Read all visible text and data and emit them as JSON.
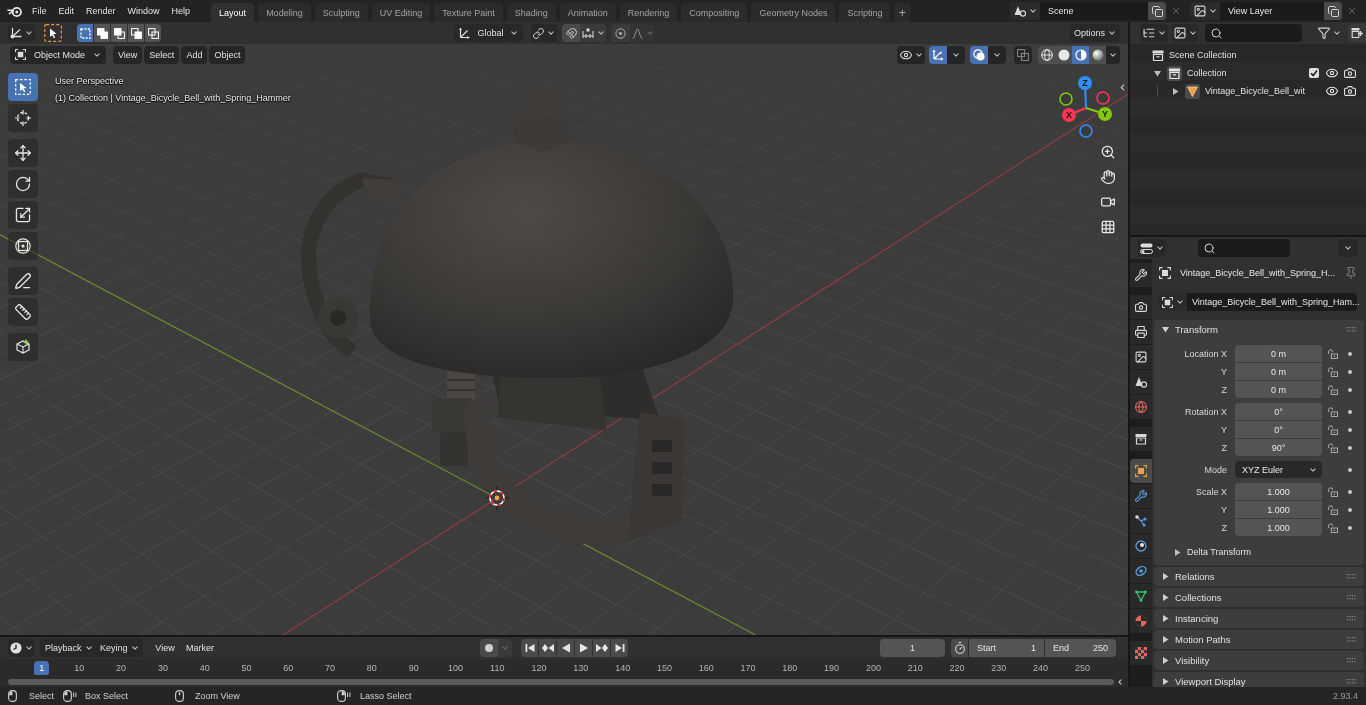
{
  "top_bar": {
    "menus": [
      "File",
      "Edit",
      "Render",
      "Window",
      "Help"
    ],
    "workspaces": [
      {
        "label": "Layout",
        "selected": true
      },
      {
        "label": "Modeling",
        "selected": false
      },
      {
        "label": "Sculpting",
        "selected": false
      },
      {
        "label": "UV Editing",
        "selected": false
      },
      {
        "label": "Texture Paint",
        "selected": false
      },
      {
        "label": "Shading",
        "selected": false
      },
      {
        "label": "Animation",
        "selected": false
      },
      {
        "label": "Rendering",
        "selected": false
      },
      {
        "label": "Compositing",
        "selected": false
      },
      {
        "label": "Geometry Nodes",
        "selected": false
      },
      {
        "label": "Scripting",
        "selected": false
      }
    ],
    "add_workspace": "+",
    "scene": "Scene",
    "view_layer": "View Layer"
  },
  "viewport": {
    "tool_header": {
      "select_modes": [
        {
          "selected": true
        },
        {
          "selected": false
        },
        {
          "selected": false
        },
        {
          "selected": false
        },
        {
          "selected": false
        }
      ],
      "orientation": "Global",
      "snap_on": false,
      "proportional_on": false,
      "options": "Options"
    },
    "header": {
      "mode": "Object Mode",
      "menus": [
        "View",
        "Select",
        "Add",
        "Object"
      ],
      "gizmos_on": true,
      "overlays_on": true,
      "xray_on": false,
      "shading": [
        {
          "selected": false
        },
        {
          "selected": false
        },
        {
          "selected": true
        },
        {
          "selected": false
        }
      ]
    },
    "tools": [
      {
        "selected": true
      },
      {
        "selected": false
      },
      {
        "selected": false
      },
      {
        "selected": false
      },
      {
        "selected": false
      },
      {
        "selected": false
      },
      {
        "selected": false
      },
      {
        "selected": false
      },
      {
        "selected": false
      }
    ],
    "info": [
      "User Perspective",
      "(1) Collection | Vintage_Bicycle_Bell_with_Spring_Hammer"
    ],
    "gizmo_axes": [
      "Z",
      "Y",
      "X"
    ]
  },
  "timeline": {
    "menus": [
      {
        "label": "Playback",
        "kind": "dropdown"
      },
      {
        "label": "Keying",
        "kind": "dropdown"
      },
      {
        "label": "View",
        "kind": "menu"
      },
      {
        "label": "Marker",
        "kind": "menu"
      }
    ],
    "current_frame": "1",
    "start": {
      "label": "Start",
      "value": "1"
    },
    "end": {
      "label": "End",
      "value": "250"
    },
    "frames": [
      {
        "label": "1",
        "selected": true
      },
      {
        "label": "10",
        "selected": false
      },
      {
        "label": "20",
        "selected": false
      },
      {
        "label": "30",
        "selected": false
      },
      {
        "label": "40",
        "selected": false
      },
      {
        "label": "50",
        "selected": false
      },
      {
        "label": "60",
        "selected": false
      },
      {
        "label": "70",
        "selected": false
      },
      {
        "label": "80",
        "selected": false
      },
      {
        "label": "90",
        "selected": false
      },
      {
        "label": "100",
        "selected": false
      },
      {
        "label": "110",
        "selected": false
      },
      {
        "label": "120",
        "selected": false
      },
      {
        "label": "130",
        "selected": false
      },
      {
        "label": "140",
        "selected": false
      },
      {
        "label": "150",
        "selected": false
      },
      {
        "label": "160",
        "selected": false
      },
      {
        "label": "170",
        "selected": false
      },
      {
        "label": "180",
        "selected": false
      },
      {
        "label": "190",
        "selected": false
      },
      {
        "label": "200",
        "selected": false
      },
      {
        "label": "210",
        "selected": false
      },
      {
        "label": "220",
        "selected": false
      },
      {
        "label": "230",
        "selected": false
      },
      {
        "label": "240",
        "selected": false
      },
      {
        "label": "250",
        "selected": false
      }
    ]
  },
  "outliner": {
    "tree": [
      {
        "label": "Scene Collection",
        "kind": "scene",
        "children": [
          {
            "label": "Collection",
            "kind": "collection",
            "expanded": true,
            "checked": true,
            "visible": true,
            "renderable": true,
            "children": [
              {
                "label": "Vintage_Bicycle_Bell_wit",
                "kind": "object",
                "expanded": false,
                "visible": true,
                "renderable": true
              }
            ]
          }
        ]
      }
    ]
  },
  "properties": {
    "tabs": [
      {
        "selected": false
      },
      {
        "selected": false
      },
      {
        "selected": false
      },
      {
        "selected": false
      },
      {
        "selected": false
      },
      {
        "selected": false
      },
      {
        "selected": false
      },
      {
        "selected": true
      },
      {
        "selected": false
      },
      {
        "selected": false
      },
      {
        "selected": false
      },
      {
        "selected": false
      },
      {
        "selected": false
      },
      {
        "selected": false
      },
      {
        "selected": false
      }
    ],
    "object_name": "Vintage_Bicycle_Bell_with_Spring_H...",
    "data_name": "Vintage_Bicycle_Bell_with_Spring_Ham...",
    "transform": {
      "title": "Transform",
      "expanded": true,
      "groups": [
        {
          "kind": "vector",
          "rows": [
            {
              "label": "Location X",
              "value": "0 m",
              "locked": false
            },
            {
              "label": "Y",
              "value": "0 m",
              "locked": false
            },
            {
              "label": "Z",
              "value": "0 m",
              "locked": false
            }
          ]
        },
        {
          "kind": "vector",
          "rows": [
            {
              "label": "Rotation X",
              "value": "0°",
              "locked": false
            },
            {
              "label": "Y",
              "value": "0°",
              "locked": false
            },
            {
              "label": "Z",
              "value": "90°",
              "locked": false
            }
          ]
        },
        {
          "kind": "dropdown",
          "rows": [
            {
              "label": "Mode",
              "value": "XYZ Euler"
            }
          ]
        },
        {
          "kind": "vector",
          "rows": [
            {
              "label": "Scale X",
              "value": "1.000",
              "locked": false
            },
            {
              "label": "Y",
              "value": "1.000",
              "locked": false
            },
            {
              "label": "Z",
              "value": "1.000",
              "locked": false
            }
          ]
        }
      ],
      "subpanels": [
        {
          "title": "Delta Transform",
          "expanded": false
        }
      ]
    },
    "panels": [
      {
        "title": "Relations",
        "expanded": false
      },
      {
        "title": "Collections",
        "expanded": false
      },
      {
        "title": "Instancing",
        "expanded": false
      },
      {
        "title": "Motion Paths",
        "expanded": false
      },
      {
        "title": "Visibility",
        "expanded": false
      },
      {
        "title": "Viewport Display",
        "expanded": false
      }
    ]
  },
  "status_bar": {
    "hints": [
      "Select",
      "Box Select",
      "Zoom View",
      "Lasso Select"
    ],
    "version": "2.93.4"
  }
}
